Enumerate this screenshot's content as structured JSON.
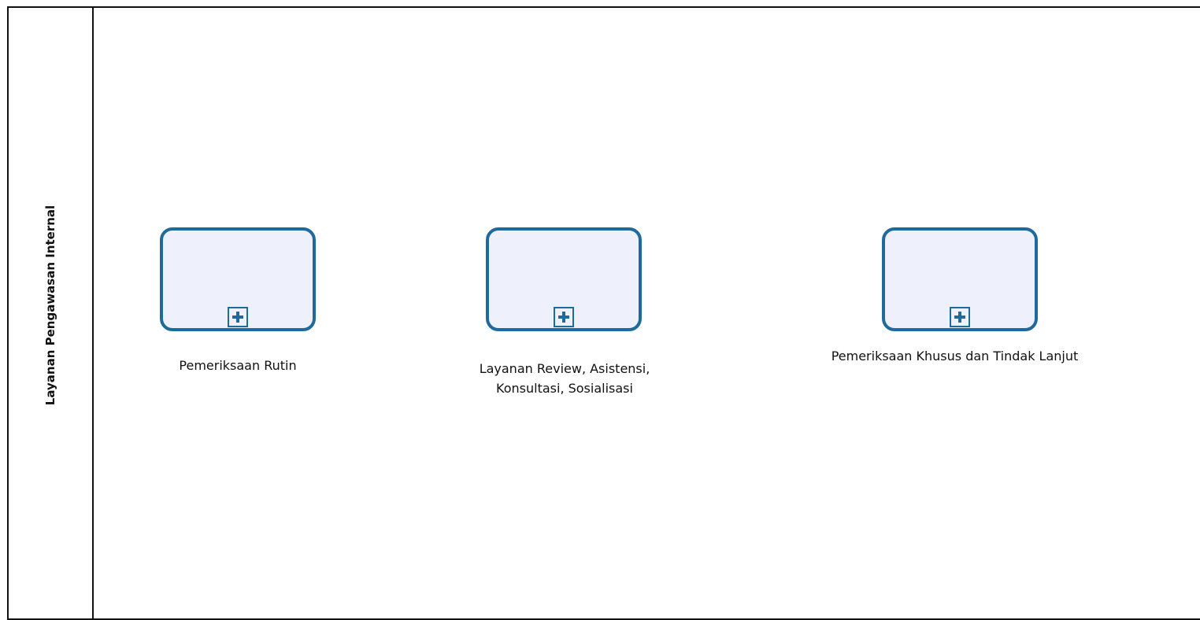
{
  "lane": {
    "label": "Layanan Pengawasan Internal"
  },
  "tasks": [
    {
      "label": "Pemeriksaan Rutin",
      "marker": "plus-icon"
    },
    {
      "label": "Layanan Review, Asistensi, Konsultasi, Sosialisasi",
      "marker": "plus-icon"
    },
    {
      "label": "Pemeriksaan Khusus dan Tindak Lanjut",
      "marker": "plus-icon"
    }
  ],
  "colors": {
    "task_border": "#1e6a9c",
    "task_fill": "#eef1fc",
    "lane_line": "#111111"
  }
}
